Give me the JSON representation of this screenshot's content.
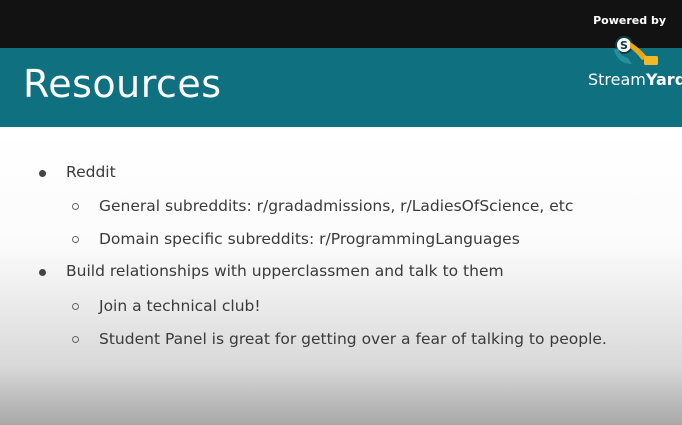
{
  "header": {
    "powered_by": "Powered by",
    "brand_stream": "Stream",
    "brand_yard": "Yard",
    "logo_icon": "streamyard-logo-icon"
  },
  "slide": {
    "title": "Resources",
    "items": [
      {
        "level": 1,
        "text": "Reddit"
      },
      {
        "level": 2,
        "text": "General subreddits: r/gradadmissions, r/LadiesOfScience, etc"
      },
      {
        "level": 2,
        "text": "Domain specific subreddits: r/ProgrammingLanguages"
      },
      {
        "level": 1,
        "text": "Build relationships with upperclassmen and talk to them"
      },
      {
        "level": 2,
        "text": "Join a technical club!"
      },
      {
        "level": 2,
        "text": "Student Panel is great for getting over a fear of talking to people."
      }
    ]
  },
  "colors": {
    "banner": "#0f7180",
    "topbar": "#121212",
    "text": "#3a3a3a"
  }
}
